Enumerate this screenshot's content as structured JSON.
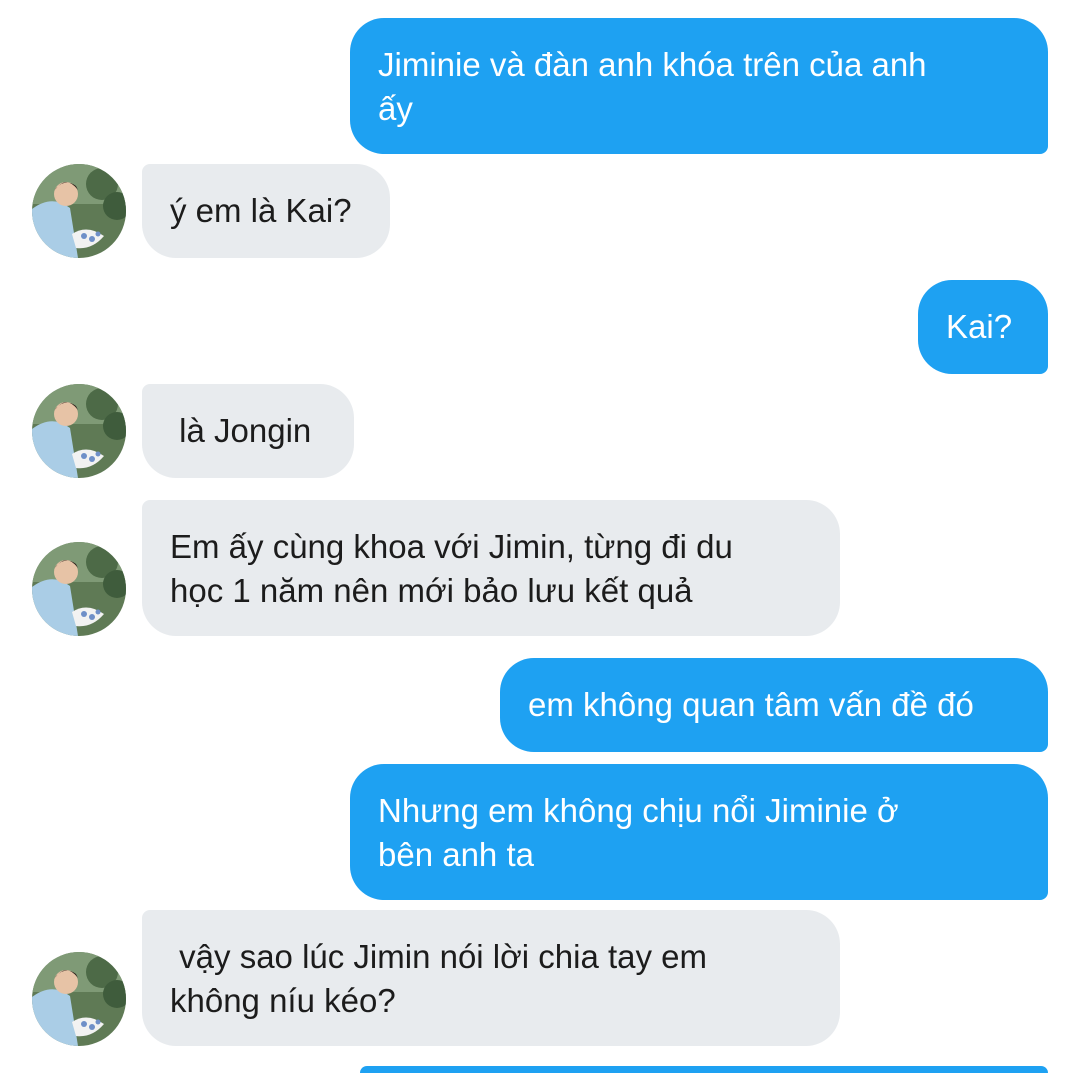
{
  "conversation": {
    "contact_avatar": "avatar-photo",
    "messages": [
      {
        "direction": "sent",
        "text": "Jiminie và đàn anh khóa trên của anh\nấy"
      },
      {
        "direction": "received",
        "text": "ý em là Kai?"
      },
      {
        "direction": "sent",
        "text": "Kai?"
      },
      {
        "direction": "received",
        "text": " là Jongin"
      },
      {
        "direction": "received",
        "text": "Em ấy cùng khoa với Jimin, từng đi du\nhọc 1 năm nên mới bảo lưu kết quả"
      },
      {
        "direction": "sent",
        "text": "em không quan tâm vấn đề đó"
      },
      {
        "direction": "sent",
        "text": "Nhưng em không chịu nổi Jiminie ở\nbên anh ta"
      },
      {
        "direction": "received",
        "text": " vậy sao lúc Jimin nói lời chia tay em\nkhông níu kéo?"
      }
    ]
  },
  "colors": {
    "sent_bubble": "#1ea1f2",
    "received_bubble": "#e8ebee",
    "background": "#ffffff"
  }
}
